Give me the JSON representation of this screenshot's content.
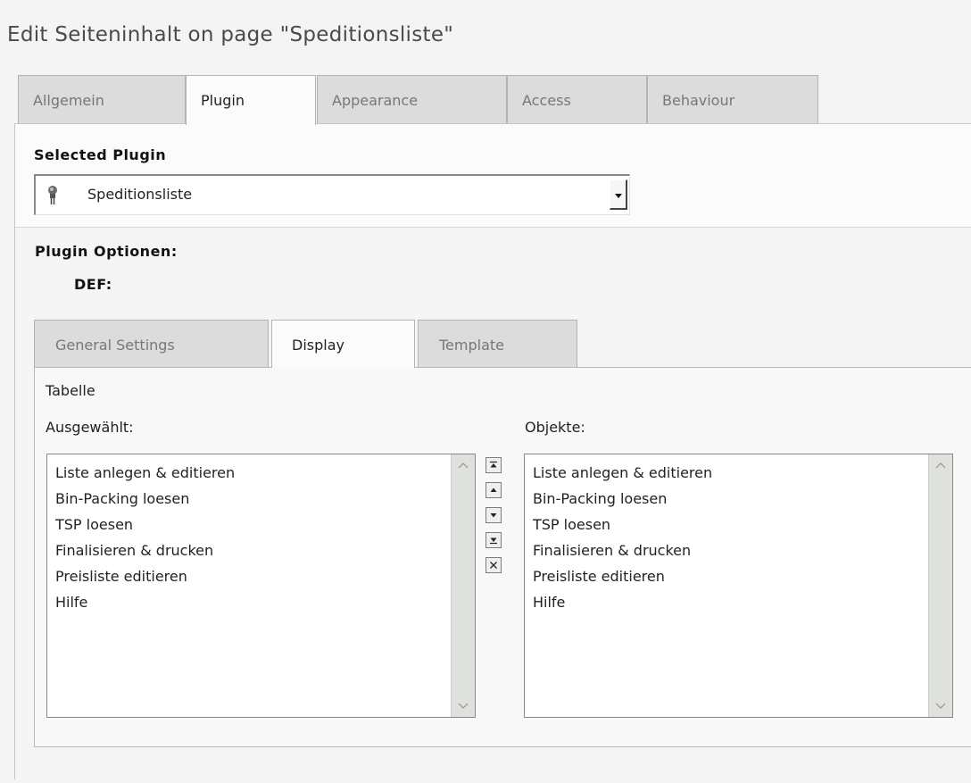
{
  "page_title": "Edit Seiteninhalt on page \"Speditionsliste\"",
  "main_tabs": [
    {
      "label": "Allgemein",
      "active": false
    },
    {
      "label": "Plugin",
      "active": true
    },
    {
      "label": "Appearance",
      "active": false
    },
    {
      "label": "Access",
      "active": false
    },
    {
      "label": "Behaviour",
      "active": false
    }
  ],
  "plugin": {
    "section_label": "Selected Plugin",
    "selected_value": "Speditionsliste",
    "icon": "plugin-plug-icon"
  },
  "options": {
    "label": "Plugin Optionen:",
    "def_label": "DEF:"
  },
  "inner_tabs": [
    {
      "label": "General Settings",
      "active": false
    },
    {
      "label": "Display",
      "active": true
    },
    {
      "label": "Template",
      "active": false
    }
  ],
  "display": {
    "group_label": "Tabelle",
    "selected_label": "Ausgewählt:",
    "objects_label": "Objekte:",
    "selected_items": [
      "Liste anlegen & editieren",
      "Bin-Packing loesen",
      "TSP loesen",
      "Finalisieren & drucken",
      "Preisliste editieren",
      "Hilfe"
    ],
    "object_items": [
      "Liste anlegen & editieren",
      "Bin-Packing loesen",
      "TSP loesen",
      "Finalisieren & drucken",
      "Preisliste editieren",
      "Hilfe"
    ],
    "controls": [
      "move-to-top-icon",
      "move-up-icon",
      "move-down-icon",
      "move-to-bottom-icon",
      "remove-icon"
    ]
  }
}
